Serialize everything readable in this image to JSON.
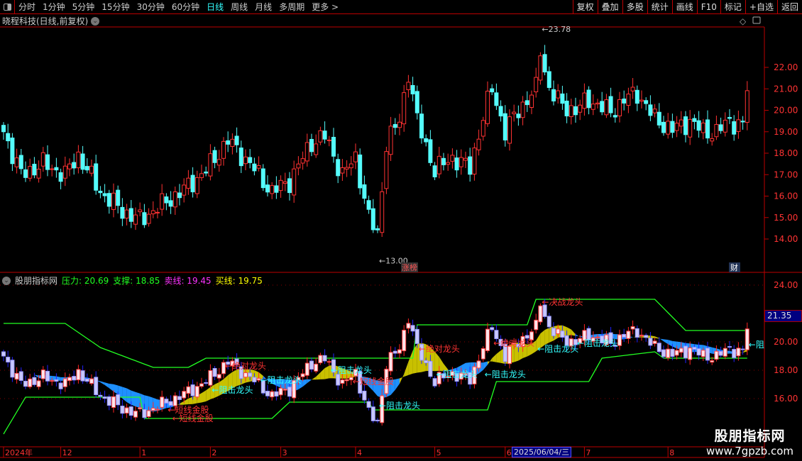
{
  "toolbar": {
    "periods": [
      "分时",
      "1分钟",
      "5分钟",
      "15分钟",
      "30分钟",
      "60分钟",
      "日线",
      "周线",
      "月线",
      "多周期",
      "更多 >"
    ],
    "active": "日线",
    "right_buttons": [
      "复权",
      "叠加",
      "多股",
      "统计",
      "画线",
      "F10",
      "标记",
      "+自选",
      "返回"
    ]
  },
  "main": {
    "title": "晓程科技(日线,前复权)",
    "price_ticks": [
      "22.00",
      "21.00",
      "20.00",
      "19.00",
      "18.00",
      "17.00",
      "16.00",
      "15.00",
      "14.00"
    ],
    "high_label": "23.78",
    "low_label": "13.00",
    "tag_zhangbang": "涨榜",
    "tag_cai": "财"
  },
  "indicator": {
    "name": "股朋指标网",
    "pressure": "压力: 20.69",
    "support": "支撑: 18.85",
    "sell": "卖线: 19.45",
    "buy": "买线: 19.75",
    "ticks": [
      "24.00",
      "20.00",
      "18.00",
      "16.00"
    ],
    "current_price": "21.35",
    "labels": [
      {
        "text": "←短线金股",
        "i": 37,
        "p": 15.2,
        "c": "#f33"
      },
      {
        "text": "←短线金股",
        "i": 38,
        "p": 14.6,
        "c": "#f33"
      },
      {
        "text": "←绝对龙头",
        "i": 50,
        "p": 18.3,
        "c": "#f33"
      },
      {
        "text": "←阻击龙头",
        "i": 47,
        "p": 16.6,
        "c": "#3ff"
      },
      {
        "text": "←阻击龙头",
        "i": 58,
        "p": 17.3,
        "c": "#3ff"
      },
      {
        "text": "←阻击龙头",
        "i": 74,
        "p": 18.0,
        "c": "#3ff"
      },
      {
        "text": "←短线金股",
        "i": 79,
        "p": 17.2,
        "c": "#f33"
      },
      {
        "text": "←阻击龙头",
        "i": 85,
        "p": 15.5,
        "c": "#3ff"
      },
      {
        "text": "←绝对龙头",
        "i": 94,
        "p": 19.5,
        "c": "#f33"
      },
      {
        "text": "←阻击龙头",
        "i": 98,
        "p": 17.7,
        "c": "#3ff"
      },
      {
        "text": "←阻击龙头",
        "i": 109,
        "p": 17.7,
        "c": "#3ff"
      },
      {
        "text": "←绝对龙头",
        "i": 111,
        "p": 19.9,
        "c": "#f33"
      },
      {
        "text": "←决战龙头",
        "i": 122,
        "p": 22.8,
        "c": "#f33"
      },
      {
        "text": "←阻击龙头",
        "i": 121,
        "p": 19.5,
        "c": "#3ff"
      },
      {
        "text": "←阻击龙头",
        "i": 130,
        "p": 19.9,
        "c": "#3ff"
      },
      {
        "text": "←阻",
        "i": 169,
        "p": 19.8,
        "c": "#3ff"
      }
    ]
  },
  "axis": {
    "dates": [
      {
        "t": "2024年",
        "i": 0
      },
      {
        "t": "12",
        "i": 13
      },
      {
        "t": "1",
        "i": 31
      },
      {
        "t": "2",
        "i": 47
      },
      {
        "t": "3",
        "i": 63
      },
      {
        "t": "4",
        "i": 80
      },
      {
        "t": "5",
        "i": 98
      },
      {
        "t": "6",
        "i": 114
      },
      {
        "t": "7",
        "i": 132
      },
      {
        "t": "8",
        "i": 151
      }
    ],
    "selected_date": "2025/06/04/三"
  },
  "watermark": {
    "name": "股朋指标网",
    "url": "www.7gpzb.com"
  },
  "chart_data": {
    "type": "candlestick",
    "candles": 170,
    "close_keypoints": [
      [
        0,
        19.0
      ],
      [
        4,
        17.0
      ],
      [
        9,
        17.5
      ],
      [
        14,
        17.0
      ],
      [
        17,
        17.9
      ],
      [
        22,
        16.2
      ],
      [
        27,
        15.3
      ],
      [
        31,
        14.9
      ],
      [
        36,
        15.6
      ],
      [
        41,
        16.3
      ],
      [
        46,
        17.2
      ],
      [
        51,
        18.6
      ],
      [
        56,
        17.5
      ],
      [
        61,
        16.2
      ],
      [
        65,
        16.7
      ],
      [
        70,
        18.5
      ],
      [
        73,
        18.8
      ],
      [
        77,
        17.0
      ],
      [
        80,
        17.8
      ],
      [
        83,
        15.0
      ],
      [
        85,
        14.2
      ],
      [
        87,
        18.5
      ],
      [
        90,
        19.5
      ],
      [
        92,
        21.8
      ],
      [
        94,
        19.5
      ],
      [
        98,
        17.2
      ],
      [
        102,
        17.8
      ],
      [
        106,
        17.3
      ],
      [
        109,
        19.7
      ],
      [
        111,
        21.0
      ],
      [
        114,
        19.0
      ],
      [
        117,
        20.0
      ],
      [
        121,
        21.0
      ],
      [
        122,
        22.8
      ],
      [
        124,
        21.0
      ],
      [
        127,
        20.2
      ],
      [
        130,
        20.0
      ],
      [
        133,
        20.5
      ],
      [
        138,
        19.9
      ],
      [
        141,
        20.5
      ],
      [
        144,
        20.8
      ],
      [
        148,
        19.6
      ],
      [
        152,
        19.1
      ],
      [
        156,
        19.5
      ],
      [
        159,
        19.0
      ],
      [
        162,
        19.0
      ],
      [
        165,
        19.5
      ],
      [
        168,
        19.3
      ],
      [
        169,
        21.0
      ]
    ],
    "pressure_line": [
      [
        0,
        21.3
      ],
      [
        14,
        21.3
      ],
      [
        22,
        19.6
      ],
      [
        34,
        18.2
      ],
      [
        42,
        18.2
      ],
      [
        46,
        18.85
      ],
      [
        93,
        18.85
      ],
      [
        94,
        21.2
      ],
      [
        119,
        21.2
      ],
      [
        121,
        23.0
      ],
      [
        148,
        23.0
      ],
      [
        155,
        20.8
      ],
      [
        169,
        20.8
      ]
    ],
    "support_line": [
      [
        0,
        13.5
      ],
      [
        5,
        16.1
      ],
      [
        31,
        16.1
      ],
      [
        32,
        14.6
      ],
      [
        61,
        14.6
      ],
      [
        65,
        15.75
      ],
      [
        83,
        15.75
      ],
      [
        84,
        15.2
      ],
      [
        110,
        15.2
      ],
      [
        112,
        17.2
      ],
      [
        133,
        17.2
      ],
      [
        136,
        18.85
      ],
      [
        148,
        19.3
      ],
      [
        150,
        18.85
      ],
      [
        169,
        18.85
      ]
    ],
    "high": 23.78,
    "low": 13.0
  }
}
